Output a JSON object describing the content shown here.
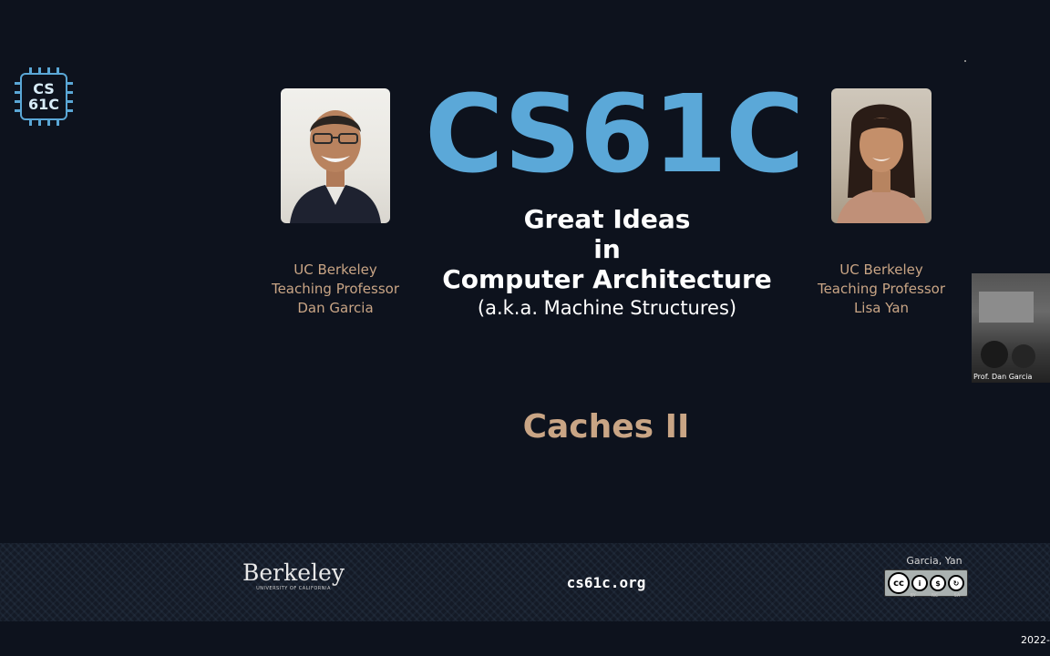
{
  "logo": {
    "line1": "CS",
    "line2": "61C"
  },
  "course": {
    "title": "CS61C",
    "subtitle_line1": "Great Ideas",
    "subtitle_line2": "in",
    "subtitle_line3": "Computer Architecture",
    "aka": "(a.k.a. Machine Structures)"
  },
  "instructors": [
    {
      "line1": "UC Berkeley",
      "line2": "Teaching Professor",
      "line3": "Dan Garcia"
    },
    {
      "line1": "UC Berkeley",
      "line2": "Teaching Professor",
      "line3": "Lisa Yan"
    }
  ],
  "lecture": {
    "title": "Caches II"
  },
  "video": {
    "label": "Prof. Dan Garcia"
  },
  "footer": {
    "berkeley": "Berkeley",
    "berkeley_sub": "UNIVERSITY OF CALIFORNIA",
    "url": "cs61c.org",
    "authors": "Garcia, Yan",
    "cc_labels": [
      "BY",
      "NC",
      "SA"
    ]
  },
  "date_fragment": "2022-",
  "colors": {
    "background": "#0d121d",
    "title_blue": "#5ba8d8",
    "accent_tan": "#c9a585"
  }
}
